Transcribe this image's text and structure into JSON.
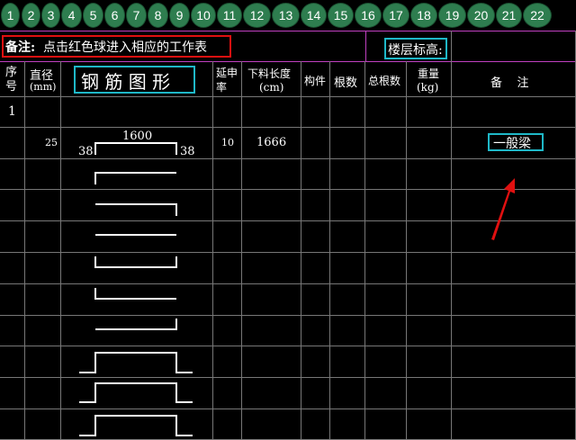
{
  "balls": [
    "1",
    "2",
    "3",
    "4",
    "5",
    "6",
    "7",
    "8",
    "9",
    "10",
    "11",
    "12",
    "13",
    "14",
    "15",
    "16",
    "17",
    "18",
    "19",
    "20",
    "21",
    "22"
  ],
  "note": {
    "label": "备注:",
    "text": "点击红色球进入相应的工作表"
  },
  "floor_height": "楼层标高:",
  "headers": {
    "seq": "序号",
    "diameter": "直径",
    "diameter_unit": "(mm)",
    "shape": "钢 筋 图 形",
    "stretch": "延申率",
    "cut_length": "下料长度",
    "cut_length_unit": "(cm)",
    "member": "构件",
    "count": "根数",
    "total_count": "总根数",
    "weight": "重量",
    "weight_unit": "(kg)",
    "remark": "备    注"
  },
  "rows": [
    {
      "seq": "1"
    },
    {
      "diameter": "25",
      "dim_top": "1600",
      "dim_left": "38",
      "dim_right": "38",
      "stretch": "10",
      "cut_length": "1666",
      "remark": "一般梁"
    }
  ]
}
